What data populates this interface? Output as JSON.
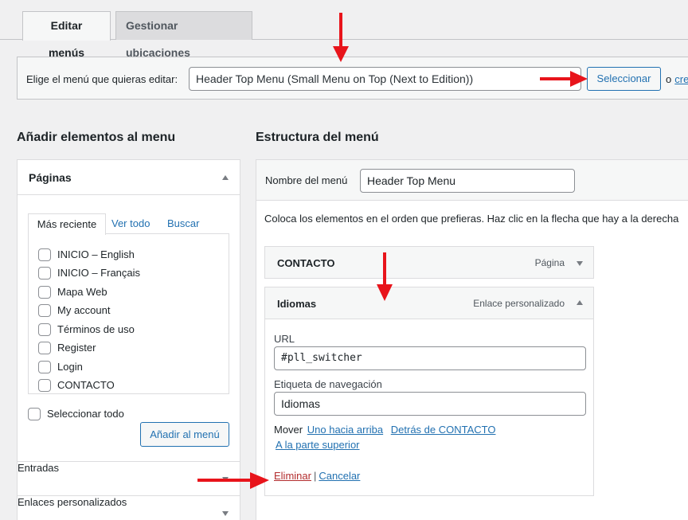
{
  "tabs": {
    "edit_menus": "Editar menús",
    "manage_locations": "Gestionar ubicaciones"
  },
  "select_bar": {
    "label": "Elige el menú que quieras editar:",
    "selected_menu": "Header Top Menu (Small Menu on Top (Next to Edition))",
    "select_button": "Seleccionar",
    "or_text": "o",
    "create_link": "cre"
  },
  "left": {
    "heading": "Añadir elementos al menu",
    "pages_box": {
      "title": "Páginas",
      "tabs": [
        "Más reciente",
        "Ver todo",
        "Buscar"
      ],
      "items": [
        "INICIO – English",
        "INICIO – Français",
        "Mapa Web",
        "My account",
        "Términos de uso",
        "Register",
        "Login",
        "CONTACTO"
      ],
      "select_all": "Seleccionar todo",
      "add_button": "Añadir al menú"
    },
    "entries_box": {
      "title": "Entradas"
    },
    "custom_links_box": {
      "title": "Enlaces personalizados"
    }
  },
  "right": {
    "heading": "Estructura del menú",
    "menu_name_label": "Nombre del menú",
    "menu_name_value": "Header Top Menu",
    "instructions": "Coloca los elementos en el orden que prefieras. Haz clic en la flecha que hay a la derecha",
    "items": [
      {
        "title": "CONTACTO",
        "type": "Página"
      },
      {
        "title": "Idiomas",
        "type": "Enlace personalizado"
      }
    ],
    "item_settings": {
      "url_label": "URL",
      "url_value": "#pll_switcher",
      "nav_label": "Etiqueta de navegación",
      "nav_value": "Idiomas",
      "move_label": "Mover",
      "move_up": "Uno hacia arriba",
      "move_after": "Detrás de CONTACTO",
      "move_top": "A la parte superior",
      "delete": "Eliminar",
      "separator": "|",
      "cancel": "Cancelar"
    }
  },
  "colors": {
    "accent": "#2271b1",
    "delete": "#b32d2e",
    "annotation_arrow": "#e8141b"
  }
}
